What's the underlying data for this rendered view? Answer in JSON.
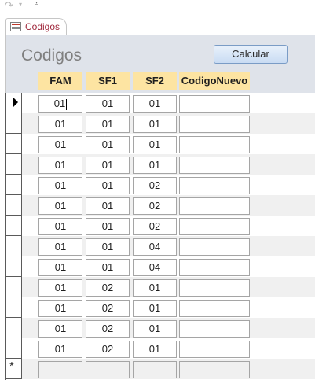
{
  "toolbar": {
    "undo_glyph": "↷",
    "dropdown_glyph": "▾",
    "customize_glyph": "⩡"
  },
  "tab": {
    "label": "Codigos",
    "accent": "#a0283c"
  },
  "form": {
    "title": "Codigos",
    "calculate_label": "Calcular"
  },
  "columns": [
    "FAM",
    "SF1",
    "SF2",
    "CodigoNuevo"
  ],
  "new_record_glyph": "*",
  "rows": [
    {
      "FAM": "01",
      "SF1": "01",
      "SF2": "01",
      "CodigoNuevo": ""
    },
    {
      "FAM": "01",
      "SF1": "01",
      "SF2": "01",
      "CodigoNuevo": ""
    },
    {
      "FAM": "01",
      "SF1": "01",
      "SF2": "01",
      "CodigoNuevo": ""
    },
    {
      "FAM": "01",
      "SF1": "01",
      "SF2": "01",
      "CodigoNuevo": ""
    },
    {
      "FAM": "01",
      "SF1": "01",
      "SF2": "02",
      "CodigoNuevo": ""
    },
    {
      "FAM": "01",
      "SF1": "01",
      "SF2": "02",
      "CodigoNuevo": ""
    },
    {
      "FAM": "01",
      "SF1": "01",
      "SF2": "02",
      "CodigoNuevo": ""
    },
    {
      "FAM": "01",
      "SF1": "01",
      "SF2": "04",
      "CodigoNuevo": ""
    },
    {
      "FAM": "01",
      "SF1": "01",
      "SF2": "04",
      "CodigoNuevo": ""
    },
    {
      "FAM": "01",
      "SF1": "02",
      "SF2": "01",
      "CodigoNuevo": ""
    },
    {
      "FAM": "01",
      "SF1": "02",
      "SF2": "01",
      "CodigoNuevo": ""
    },
    {
      "FAM": "01",
      "SF1": "02",
      "SF2": "01",
      "CodigoNuevo": ""
    },
    {
      "FAM": "01",
      "SF1": "02",
      "SF2": "01",
      "CodigoNuevo": ""
    }
  ],
  "colors": {
    "header_bg": "#fde4a2",
    "form_header_bg": "#dfe3ea",
    "alt_row": "#f0f0f0",
    "button_border": "#7a9cc6"
  }
}
